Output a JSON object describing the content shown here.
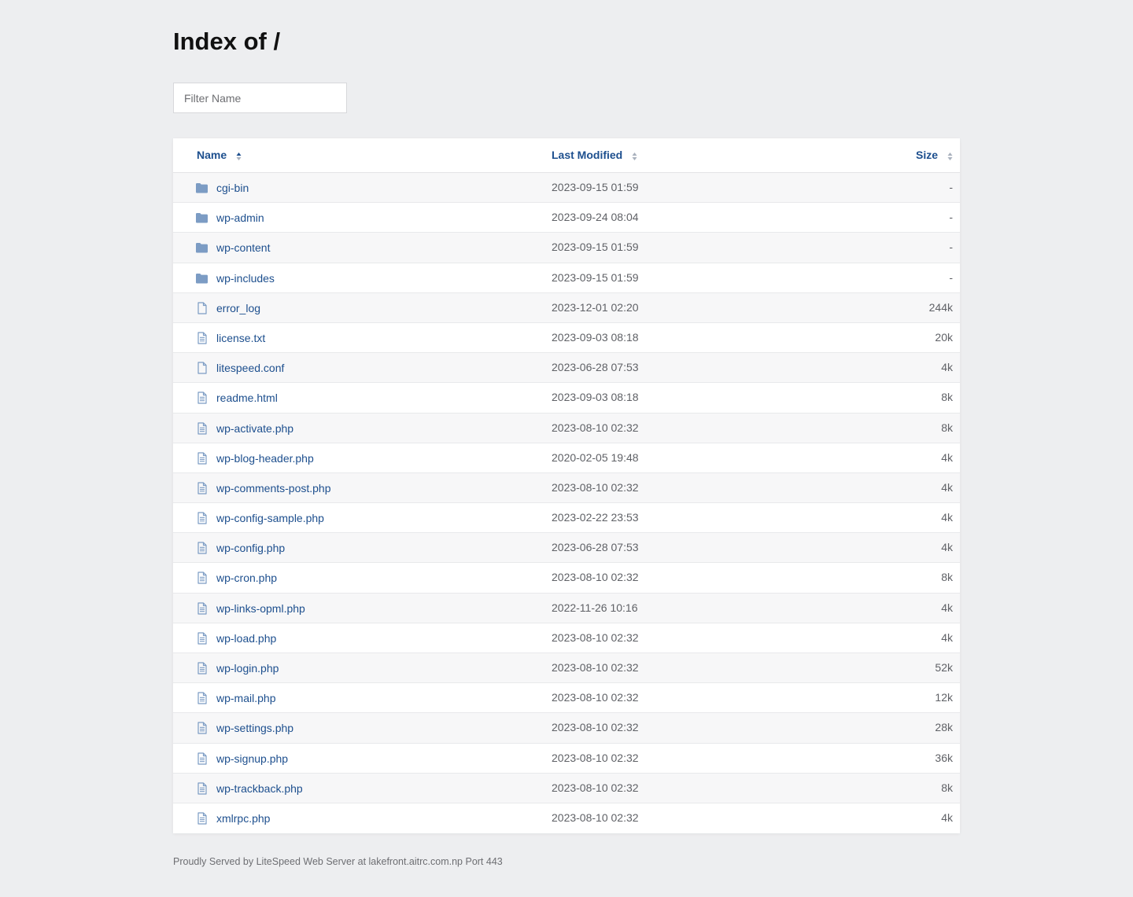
{
  "page": {
    "title": "Index of /",
    "filter_placeholder": "Filter Name",
    "footer": "Proudly Served by LiteSpeed Web Server at lakefront.aitrc.com.np Port 443"
  },
  "table": {
    "headers": {
      "name": "Name",
      "last_modified": "Last Modified",
      "size": "Size"
    },
    "rows": [
      {
        "type": "folder",
        "name": "cgi-bin",
        "modified": "2023-09-15 01:59",
        "size": "-"
      },
      {
        "type": "folder",
        "name": "wp-admin",
        "modified": "2023-09-24 08:04",
        "size": "-"
      },
      {
        "type": "folder",
        "name": "wp-content",
        "modified": "2023-09-15 01:59",
        "size": "-"
      },
      {
        "type": "folder",
        "name": "wp-includes",
        "modified": "2023-09-15 01:59",
        "size": "-"
      },
      {
        "type": "file",
        "name": "error_log",
        "modified": "2023-12-01 02:20",
        "size": "244k"
      },
      {
        "type": "text",
        "name": "license.txt",
        "modified": "2023-09-03 08:18",
        "size": "20k"
      },
      {
        "type": "file",
        "name": "litespeed.conf",
        "modified": "2023-06-28 07:53",
        "size": "4k"
      },
      {
        "type": "text",
        "name": "readme.html",
        "modified": "2023-09-03 08:18",
        "size": "8k"
      },
      {
        "type": "text",
        "name": "wp-activate.php",
        "modified": "2023-08-10 02:32",
        "size": "8k"
      },
      {
        "type": "text",
        "name": "wp-blog-header.php",
        "modified": "2020-02-05 19:48",
        "size": "4k"
      },
      {
        "type": "text",
        "name": "wp-comments-post.php",
        "modified": "2023-08-10 02:32",
        "size": "4k"
      },
      {
        "type": "text",
        "name": "wp-config-sample.php",
        "modified": "2023-02-22 23:53",
        "size": "4k"
      },
      {
        "type": "text",
        "name": "wp-config.php",
        "modified": "2023-06-28 07:53",
        "size": "4k"
      },
      {
        "type": "text",
        "name": "wp-cron.php",
        "modified": "2023-08-10 02:32",
        "size": "8k"
      },
      {
        "type": "text",
        "name": "wp-links-opml.php",
        "modified": "2022-11-26 10:16",
        "size": "4k"
      },
      {
        "type": "text",
        "name": "wp-load.php",
        "modified": "2023-08-10 02:32",
        "size": "4k"
      },
      {
        "type": "text",
        "name": "wp-login.php",
        "modified": "2023-08-10 02:32",
        "size": "52k"
      },
      {
        "type": "text",
        "name": "wp-mail.php",
        "modified": "2023-08-10 02:32",
        "size": "12k"
      },
      {
        "type": "text",
        "name": "wp-settings.php",
        "modified": "2023-08-10 02:32",
        "size": "28k"
      },
      {
        "type": "text",
        "name": "wp-signup.php",
        "modified": "2023-08-10 02:32",
        "size": "36k"
      },
      {
        "type": "text",
        "name": "wp-trackback.php",
        "modified": "2023-08-10 02:32",
        "size": "8k"
      },
      {
        "type": "text",
        "name": "xmlrpc.php",
        "modified": "2023-08-10 02:32",
        "size": "4k"
      }
    ]
  },
  "colors": {
    "background": "#edeef0",
    "link": "#1d4f8e",
    "icon": "#7c9cc4",
    "muted_text": "#5f6166"
  },
  "icons": {
    "folder": "folder-icon",
    "file": "file-icon",
    "text": "text-file-icon",
    "sort": "sort-icon"
  }
}
